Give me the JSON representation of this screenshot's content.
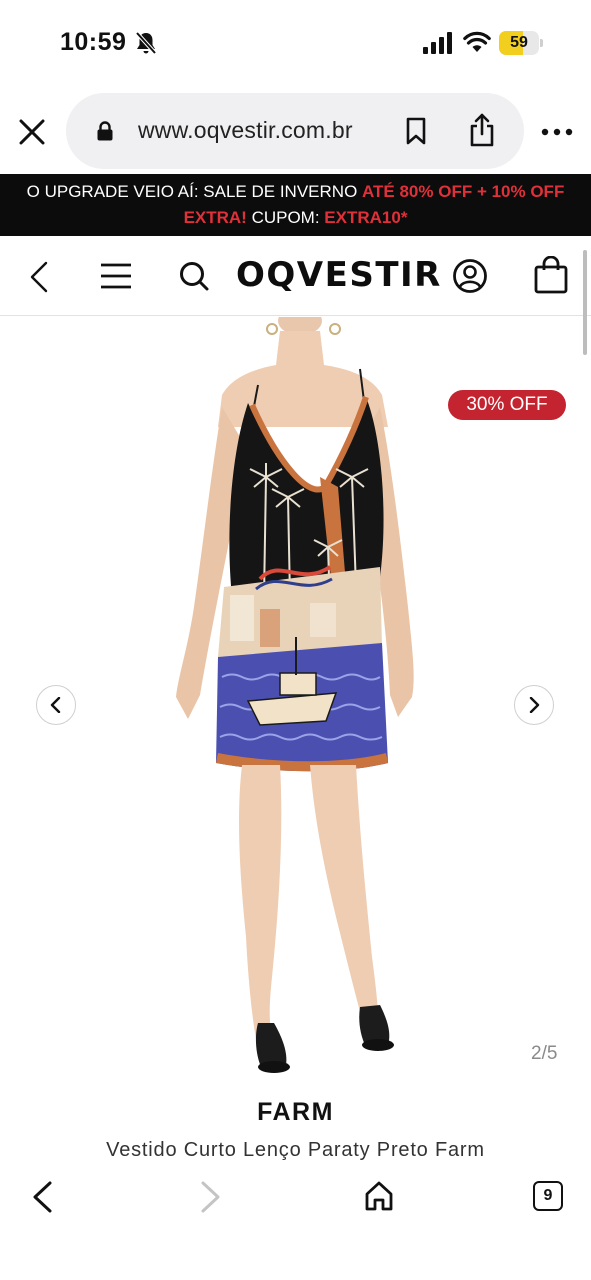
{
  "status_bar": {
    "time": "10:59",
    "battery_level": "59",
    "battery_fraction": 0.59
  },
  "browser": {
    "url": "www.oqvestir.com.br",
    "tab_count": "9"
  },
  "promo": {
    "part1": "O UPGRADE VEIO AÍ: SALE DE INVERNO ",
    "part2": "ATÉ 80% OFF + 10% OFF",
    "part3": "EXTRA!",
    "part4": " CUPOM: ",
    "part5": "EXTRA10*",
    "accent_color": "#e0303a"
  },
  "header": {
    "logo": "OQVESTIR"
  },
  "product": {
    "discount_badge": "30% OFF",
    "image_counter": "2/5",
    "brand": "FARM",
    "title": "Vestido Curto Lenço Paraty Preto Farm",
    "badge_color": "#c3242f"
  }
}
